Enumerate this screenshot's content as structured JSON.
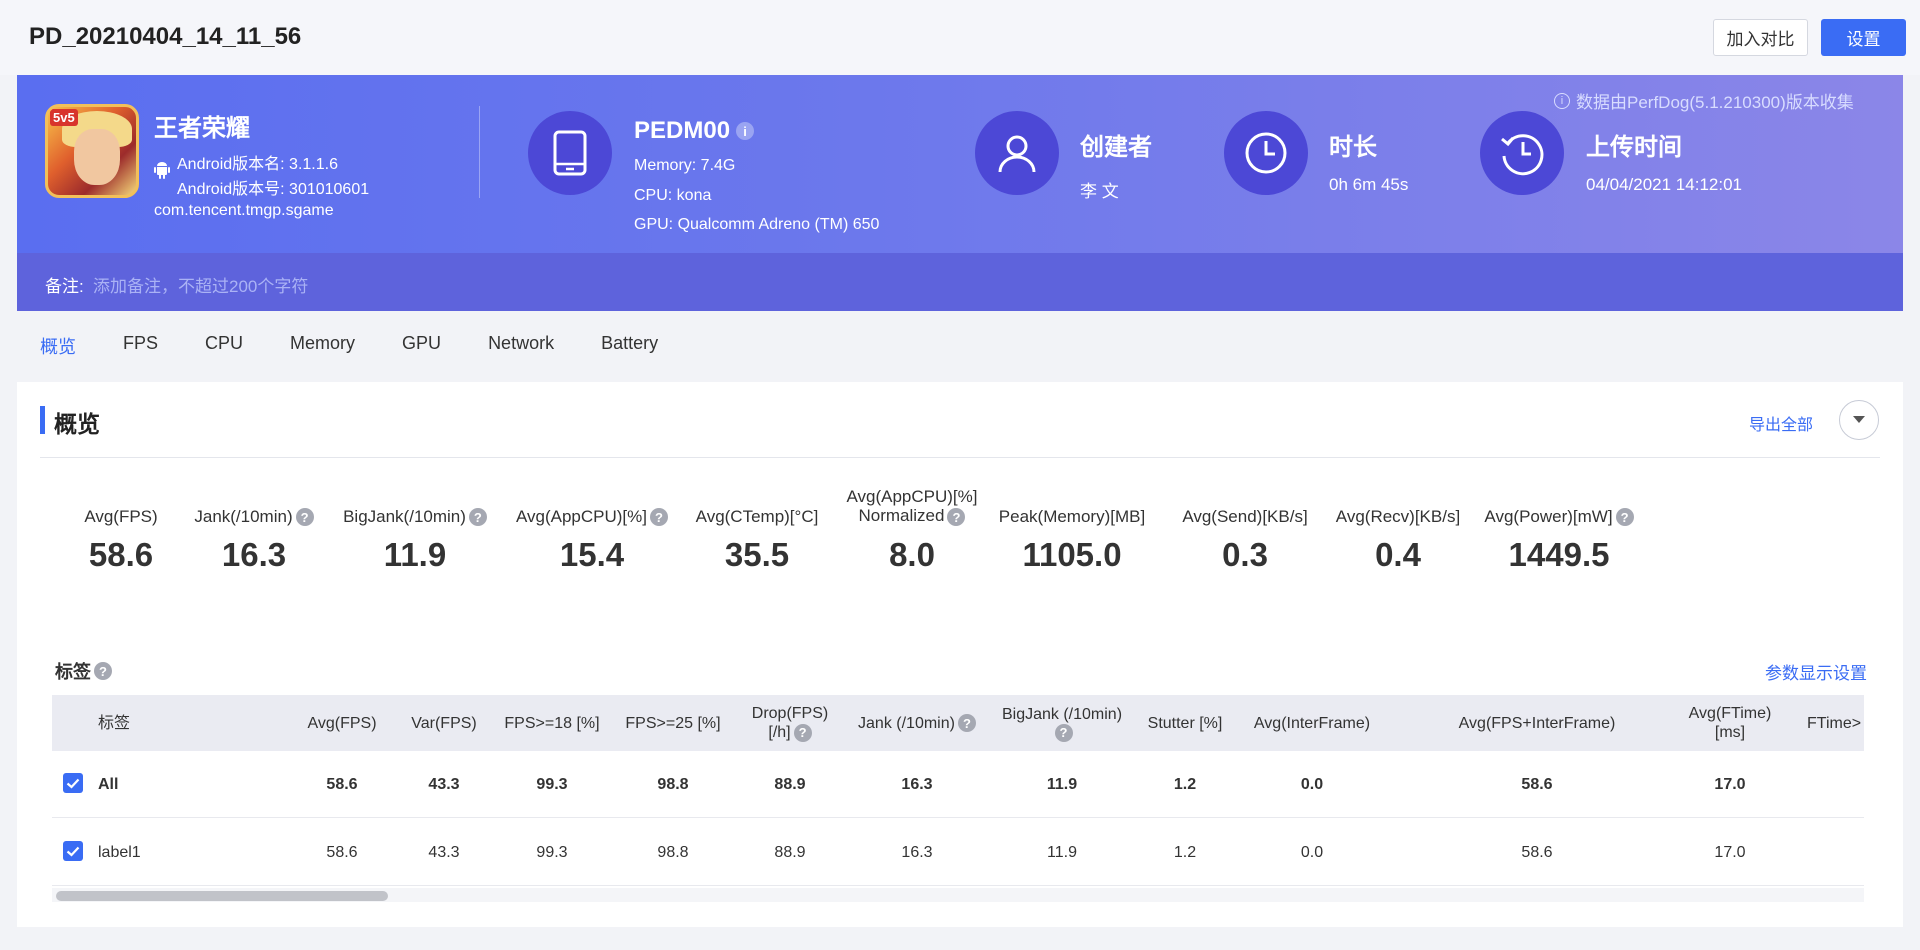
{
  "header": {
    "title": "PD_20210404_14_11_56",
    "compare_label": "加入对比",
    "settings_label": "设置"
  },
  "app": {
    "name": "王者荣耀",
    "icon_badge": "5v5",
    "version_name": "Android版本名: 3.1.1.6",
    "version_code": "Android版本号: 301010601",
    "package": "com.tencent.tmgp.sgame"
  },
  "device": {
    "name": "PEDM00",
    "memory": "Memory: 7.4G",
    "cpu": "CPU: kona",
    "gpu": "GPU: Qualcomm Adreno (TM) 650"
  },
  "creator": {
    "title": "创建者",
    "value": "李 文"
  },
  "duration": {
    "title": "时长",
    "value": "0h 6m 45s"
  },
  "upload": {
    "title": "上传时间",
    "value": "04/04/2021 14:12:01"
  },
  "source_info": "数据由PerfDog(5.1.210300)版本收集",
  "note": {
    "label": "备注:",
    "placeholder": "添加备注，不超过200个字符"
  },
  "tabs": [
    "概览",
    "FPS",
    "CPU",
    "Memory",
    "GPU",
    "Network",
    "Battery"
  ],
  "overview": {
    "title": "概览",
    "export_label": "导出全部",
    "metrics": [
      {
        "label": "Avg(FPS)",
        "value": "58.6"
      },
      {
        "label": "Jank(/10min)",
        "value": "16.3"
      },
      {
        "label": "BigJank(/10min)",
        "value": "11.9"
      },
      {
        "label": "Avg(AppCPU)[%]",
        "value": "15.4"
      },
      {
        "label": "Avg(CTemp)[°C]",
        "value": "35.5"
      },
      {
        "label_line1": "Avg(AppCPU)[%]",
        "label_line2": "Normalized",
        "value": "8.0"
      },
      {
        "label": "Peak(Memory)[MB]",
        "value": "1105.0"
      },
      {
        "label": "Avg(Send)[KB/s]",
        "value": "0.3"
      },
      {
        "label": "Avg(Recv)[KB/s]",
        "value": "0.4"
      },
      {
        "label": "Avg(Power)[mW]",
        "value": "1449.5"
      }
    ]
  },
  "tags": {
    "title": "标签",
    "param_settings": "参数显示设置",
    "columns": {
      "label": "标签",
      "avg_fps": "Avg(FPS)",
      "var_fps": "Var(FPS)",
      "fps18": "FPS>=18 [%]",
      "fps25": "FPS>=25 [%]",
      "drop_line1": "Drop(FPS)",
      "drop_line2": "[/h]",
      "jank": "Jank (/10min)",
      "bigjank": "BigJank (/10min)",
      "stutter": "Stutter [%]",
      "avg_interframe": "Avg(InterFrame)",
      "avg_fps_interframe": "Avg(FPS+InterFrame)",
      "ftime_line1": "Avg(FTime)",
      "ftime_line2": "[ms]",
      "ftime_more": "FTime>"
    },
    "rows": [
      {
        "label": "All",
        "avg_fps": "58.6",
        "var_fps": "43.3",
        "fps18": "99.3",
        "fps25": "98.8",
        "drop": "88.9",
        "jank": "16.3",
        "bigjank": "11.9",
        "stutter": "1.2",
        "avg_interframe": "0.0",
        "avg_fps_interframe": "58.6",
        "ftime": "17.0",
        "checked": true
      },
      {
        "label": "label1",
        "avg_fps": "58.6",
        "var_fps": "43.3",
        "fps18": "99.3",
        "fps25": "98.8",
        "drop": "88.9",
        "jank": "16.3",
        "bigjank": "11.9",
        "stutter": "1.2",
        "avg_interframe": "0.0",
        "avg_fps_interframe": "58.6",
        "ftime": "17.0",
        "checked": true
      }
    ]
  },
  "colors": {
    "accent": "#3a6cf4",
    "banner": "#5a6ef0",
    "circle": "#4c48d6"
  }
}
